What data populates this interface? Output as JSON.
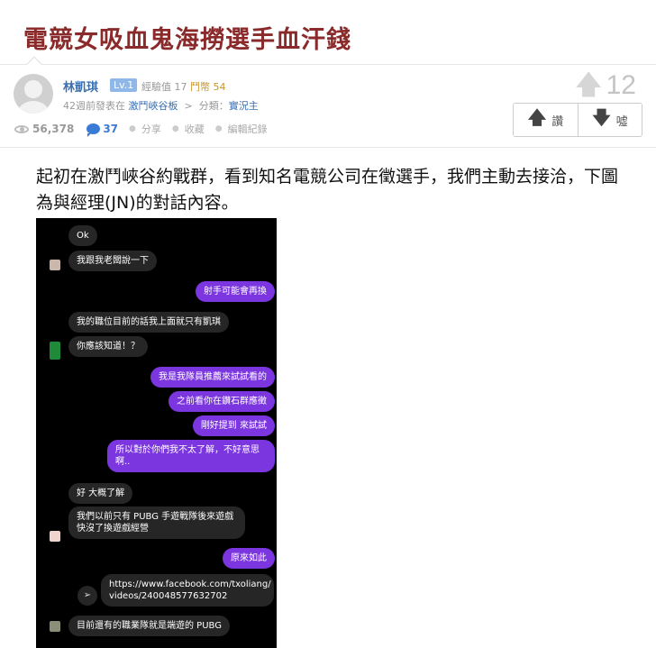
{
  "article": {
    "title": "電競女吸血鬼海撈選手血汗錢"
  },
  "author": {
    "name": "林凱琪",
    "level": "Lv.1",
    "exp_label": "經驗值",
    "exp_value": "17",
    "coin_label": "鬥幣",
    "coin_value": "54"
  },
  "post_info": {
    "posted_prefix": "42週前發表在",
    "board": "激鬥峽谷板",
    "separator": ">",
    "category_prefix": "分類：",
    "category": "實況主"
  },
  "stats": {
    "views": "56,378",
    "comments": "37",
    "share": "分享",
    "favorite": "收藏",
    "edit_log": "編輯紀錄"
  },
  "score": {
    "value": "12"
  },
  "votes": {
    "upvote_label": "讚",
    "downvote_label": "噓"
  },
  "body": {
    "paragraph": "起初在激鬥峽谷約戰群，看到知名電競公司在徵選手，我們主動去接洽，下圖為與經理(JN)的對話內容。"
  },
  "chat": {
    "messages": [
      "Ok",
      "我跟我老闆說一下",
      "射手可能會再換",
      "我的職位目前的話我上面就只有凱琪",
      "你應該知道！？",
      "我是我隊員推薦來試試看的",
      "之前看你在鑽石群應徵",
      "剛好提到 來試試",
      "所以對於你們我不太了解，不好意思",
      "啊..",
      "好 大概了解",
      "我們以前只有 PUBG 手遊戰隊後來遊戲",
      "快沒了換遊戲經營",
      "原來如此",
      "https://www.facebook.com/txoliang/",
      "videos/240048577632702",
      "目前還有的職業隊就是端遊的 PUBG"
    ],
    "colors": {
      "incoming": "#262626",
      "outgoing": "#7b36e0"
    }
  },
  "icons": {
    "avatar": "default-avatar-icon",
    "views": "eye-icon",
    "comments": "speech-bubble-icon",
    "upvote": "arrow-up-icon",
    "downvote": "arrow-down-icon",
    "share": "paper-plane-icon"
  }
}
